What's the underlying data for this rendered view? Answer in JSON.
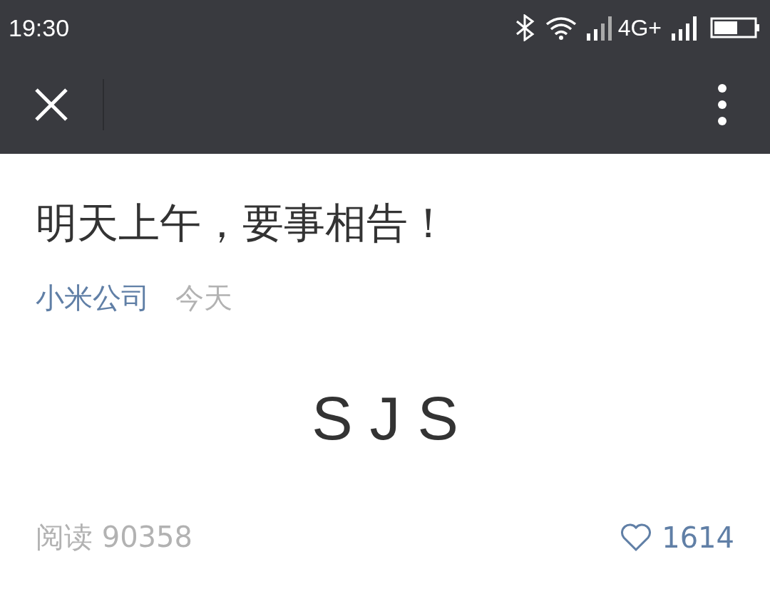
{
  "status_bar": {
    "time": "19:30",
    "network": "4G+"
  },
  "article": {
    "title": "明天上午，要事相告！",
    "author": "小米公司",
    "date": "今天",
    "body": "S J S",
    "reads": "阅读 90358",
    "likes": "1614"
  }
}
